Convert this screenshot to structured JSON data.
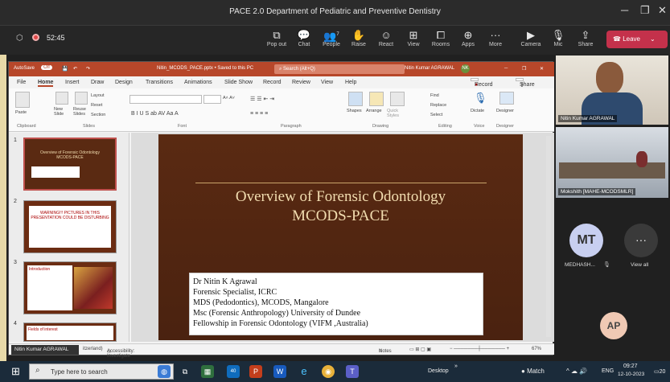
{
  "teams": {
    "window_title": "PACE 2.0 Department of Pediatric and Preventive Dentistry",
    "timer": "52:45",
    "toolbar": [
      "Pop out",
      "Chat",
      "People",
      "Raise",
      "React",
      "View",
      "Rooms",
      "Apps",
      "More",
      "Camera",
      "Mic",
      "Share"
    ],
    "people_count": "7",
    "leave_label": "Leave"
  },
  "powerpoint": {
    "autosave": "AutoSave",
    "autosave_state": "Off",
    "filename": "Nitin_MCODS_PACE.pptx • Saved to this PC",
    "search_placeholder": "Search (Alt+Q)",
    "user": "Nitin Kumar AGRAWAL",
    "user_initials": "NK",
    "menu": [
      "File",
      "Home",
      "Insert",
      "Draw",
      "Design",
      "Transitions",
      "Animations",
      "Slide Show",
      "Record",
      "Review",
      "View",
      "Help"
    ],
    "record_btn": "Record",
    "share_btn": "Share",
    "groups": [
      "Clipboard",
      "Slides",
      "Font",
      "Paragraph",
      "Drawing",
      "Editing",
      "Voice",
      "Designer"
    ],
    "ribbon": {
      "paste": "Paste",
      "new_slide": "New Slide",
      "reuse_slides": "Reuse Slides",
      "layout": "Layout",
      "reset": "Reset",
      "section": "Section",
      "shapes": "Shapes",
      "arrange": "Arrange",
      "quick_styles": "Quick Styles",
      "find": "Find",
      "replace": "Replace",
      "select": "Select",
      "dictate": "Dictate",
      "designer": "Designer"
    },
    "thumbnails": [
      {
        "num": "1",
        "text": "Overview of Forensic Odontology MCODS-PACE"
      },
      {
        "num": "2",
        "text": "WARNING!!! PICTURES IN THIS PRESENTATION COULD BE DISTURBING"
      },
      {
        "num": "3",
        "text": "Introduction"
      },
      {
        "num": "4",
        "text": "Fields of interest"
      }
    ],
    "slide": {
      "title_line1": "Overview of Forensic Odontology",
      "title_line2": "MCODS-PACE",
      "lines": [
        "Dr  Nitin K Agrawal",
        "Forensic Specialist, ICRC",
        "MDS (Pedodontics), MCODS, Mangalore",
        "Msc  (Forensic Anthropology) University of Dundee",
        "Fellowship in Forensic Odontology (VIFM ,Australia)"
      ]
    },
    "status": {
      "chip": "Nitin Kumar AGRAWAL",
      "language": "itzerland)",
      "accessibility": "Accessibility: Investigate",
      "notes": "Notes",
      "zoom": "67%"
    }
  },
  "participants": {
    "p1_name": "Nitin Kumar AGRAWAL",
    "p2_name": "Mokshith [MAHE-MCODSMLR]",
    "mt_initials": "MT",
    "mt_name": "MEDHASH...",
    "view_all": "View all",
    "ap_initials": "AP"
  },
  "taskbar": {
    "search": "Type here to search",
    "badge": "40",
    "desktop": "Desktop",
    "match": "Match",
    "lang": "ENG",
    "time": "09:27",
    "date": "12-10-2023",
    "notif": "20"
  }
}
